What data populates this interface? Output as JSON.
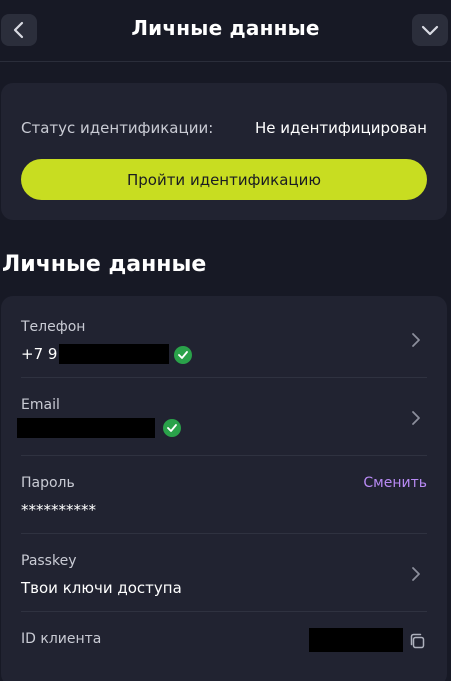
{
  "header": {
    "title": "Личные данные",
    "back_icon": "chevron-left-icon",
    "menu_icon": "chevron-down-icon"
  },
  "status_card": {
    "label": "Статус идентификации:",
    "value": "Не идентифицирован",
    "button_label": "Пройти идентификацию"
  },
  "section": {
    "title": "Личные данные"
  },
  "rows": {
    "phone": {
      "label": "Телефон",
      "value_prefix": "+7 9",
      "verified": true
    },
    "email": {
      "label": "Email",
      "verified": true
    },
    "password": {
      "label": "Пароль",
      "value": "**********",
      "action": "Сменить"
    },
    "passkey": {
      "label": "Passkey",
      "value": "Твои ключи доступа"
    },
    "client_id": {
      "label": "ID клиента",
      "copy_icon": "copy-icon"
    }
  },
  "colors": {
    "background": "#171925",
    "card": "#212331",
    "accent": "#c8dd21",
    "link": "#b88af4",
    "verified": "#2aa24a"
  }
}
